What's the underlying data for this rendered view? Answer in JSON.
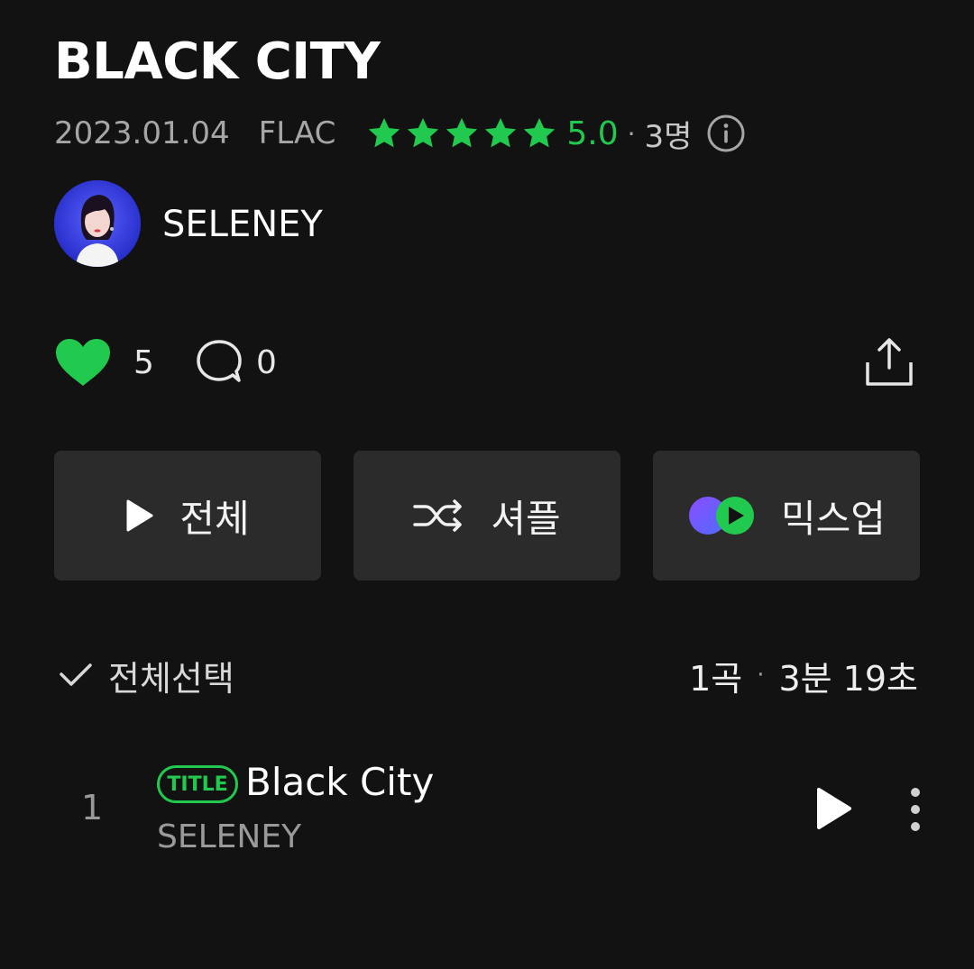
{
  "album": {
    "title": "BLACK CITY",
    "release_date": "2023.01.04",
    "format": "FLAC",
    "rating": {
      "stars": 5,
      "value": "5.0",
      "raters": "3명"
    }
  },
  "artist": {
    "name": "SELENEY"
  },
  "stats": {
    "likes": "5",
    "comments": "0"
  },
  "actions": {
    "play_all": "전체",
    "shuffle": "셔플",
    "mixup": "믹스업"
  },
  "tracklist": {
    "select_all": "전체선택",
    "song_count": "1곡",
    "total_duration": "3분 19초",
    "tracks": [
      {
        "number": "1",
        "badge": "TITLE",
        "title": "Black City",
        "artist": "SELENEY"
      }
    ]
  },
  "colors": {
    "accent": "#22c94f",
    "background": "#121212",
    "button_bg": "#2b2b2b"
  },
  "icons": [
    "star-icon",
    "info-icon",
    "heart-icon",
    "comment-icon",
    "share-icon",
    "play-icon",
    "shuffle-icon",
    "mixup-icon",
    "check-icon",
    "more-icon"
  ]
}
